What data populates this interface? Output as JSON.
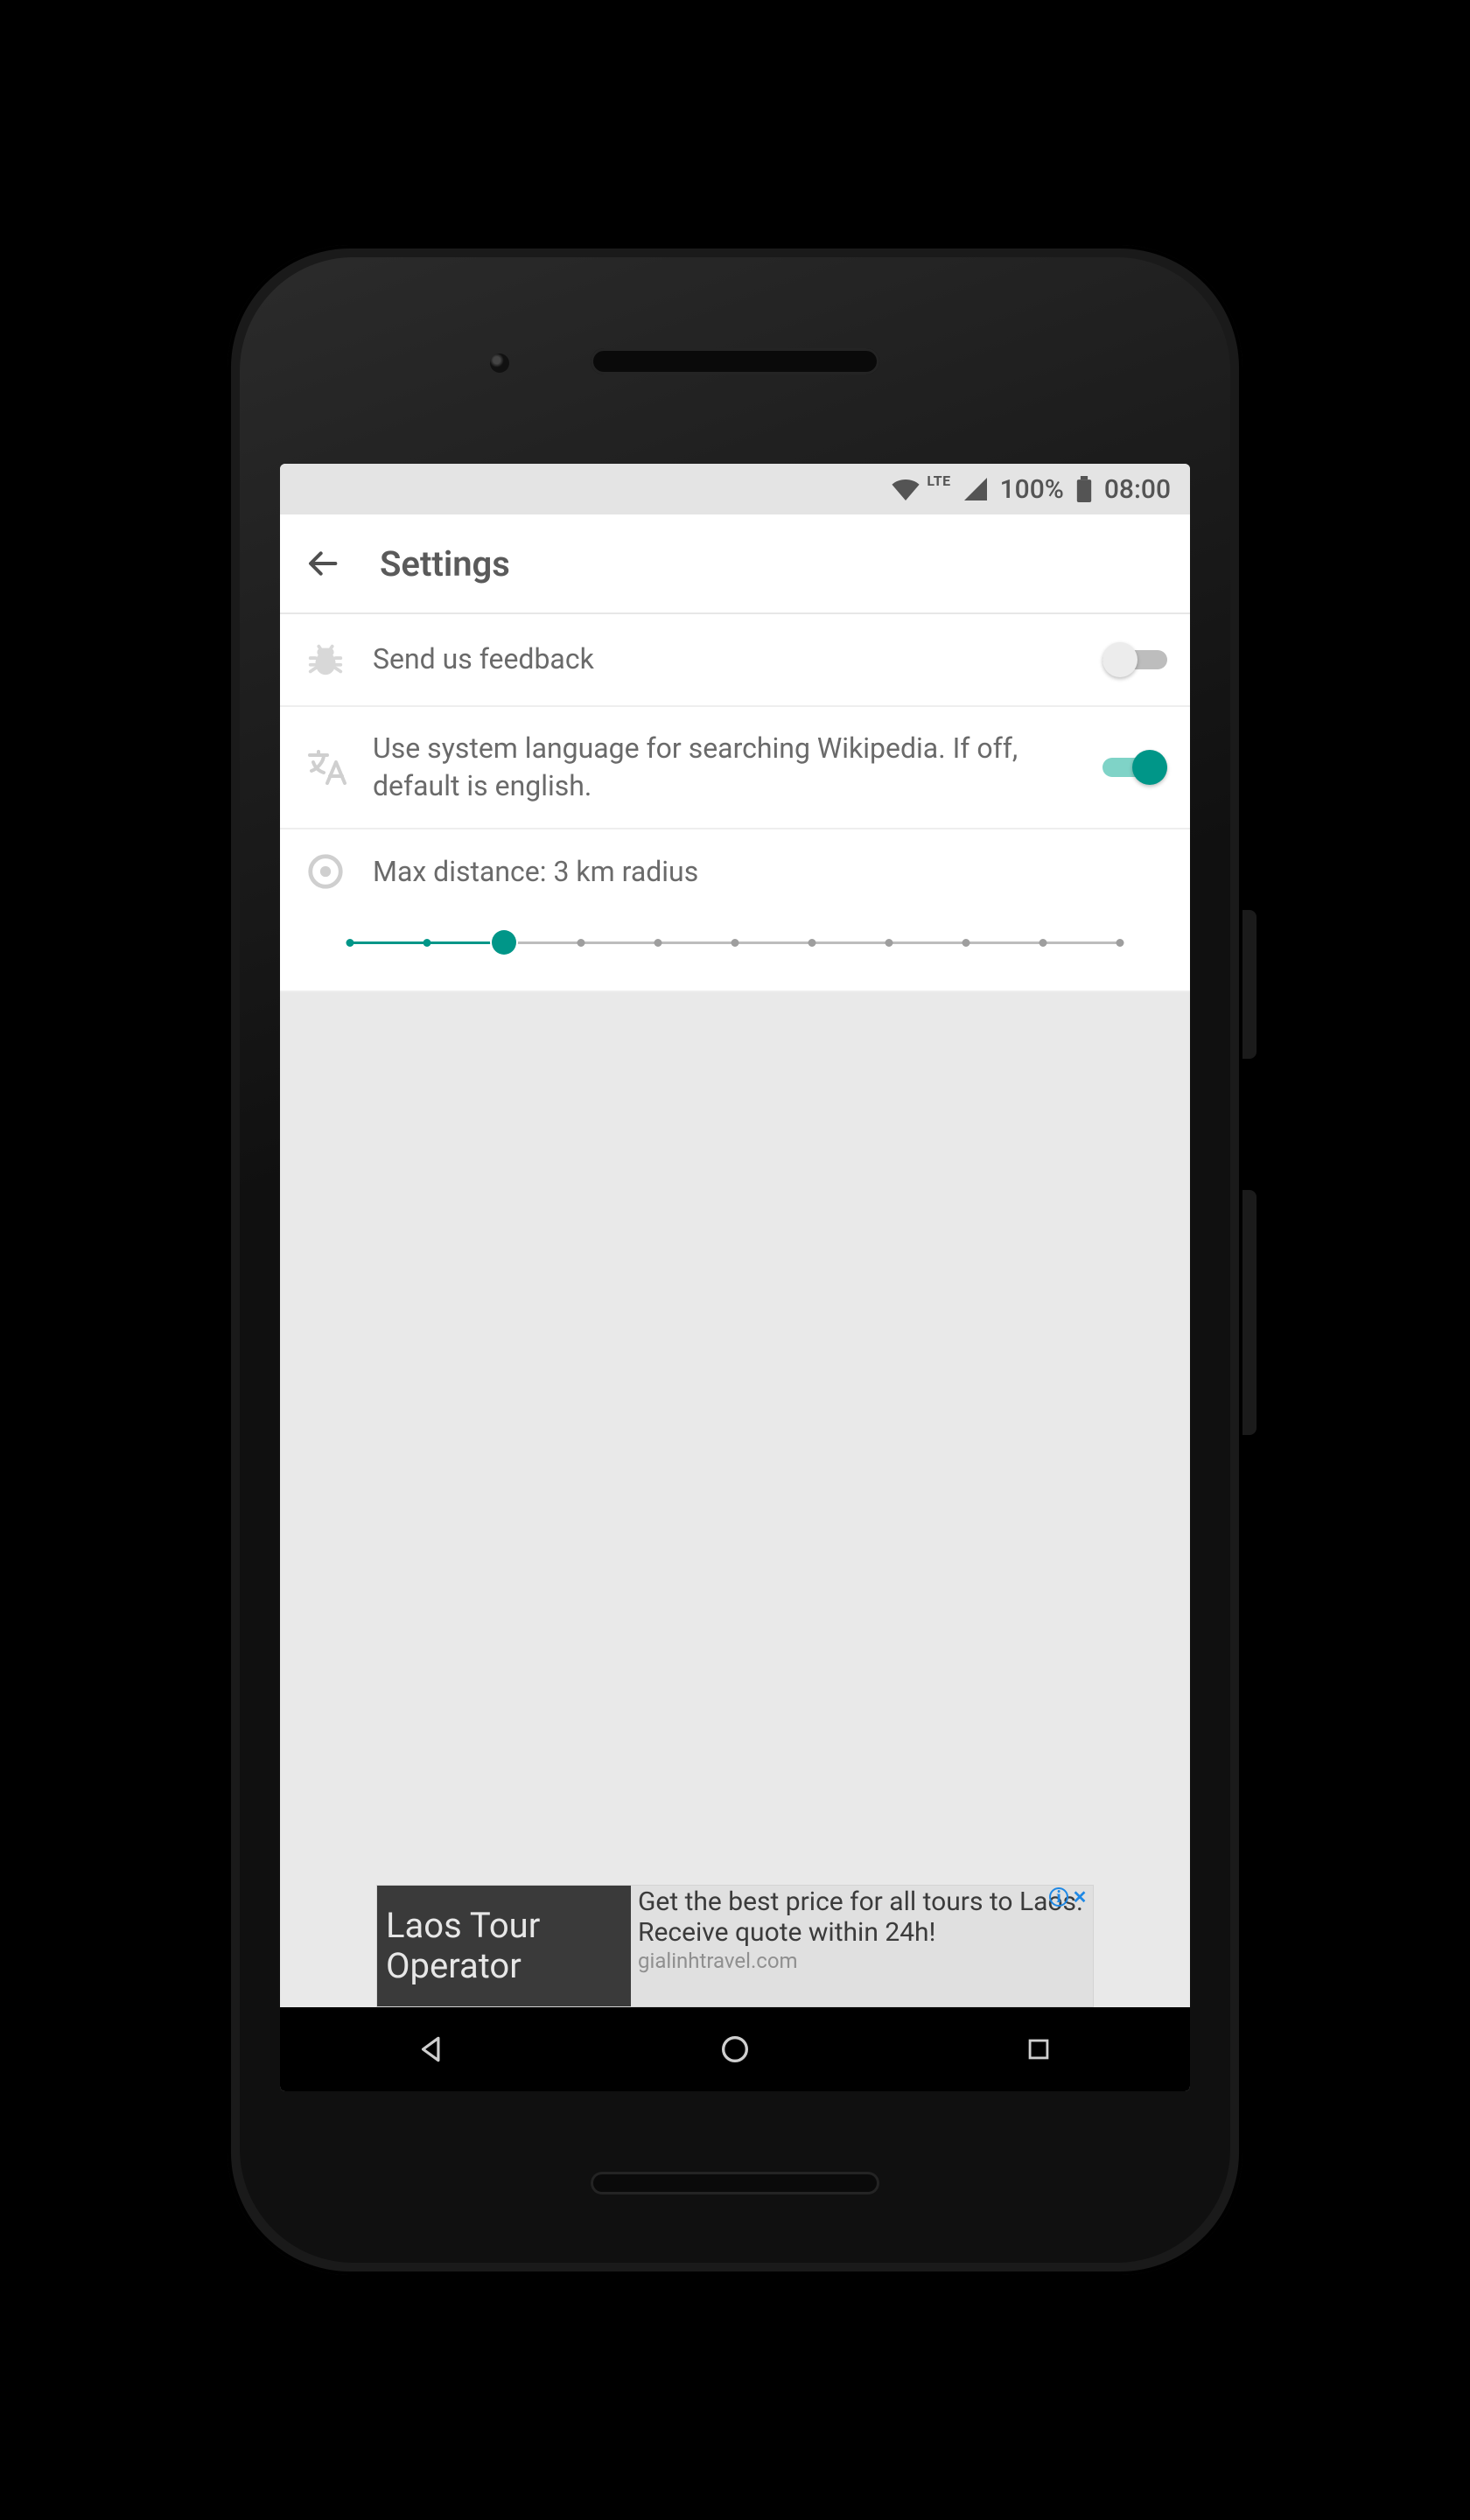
{
  "statusbar": {
    "battery_pct": "100%",
    "clock": "08:00",
    "network_label": "LTE"
  },
  "appbar": {
    "title": "Settings"
  },
  "settings": {
    "feedback": {
      "label": "Send us feedback",
      "toggle_on": false
    },
    "language": {
      "label": "Use system language for searching Wikipedia. If off, default is english.",
      "toggle_on": true
    },
    "distance": {
      "label": "Max distance: 3 km radius",
      "value_index": 2,
      "tick_count": 11
    }
  },
  "ad": {
    "headline": "Laos Tour Operator",
    "body": "Get the best price for all tours to Laos. Receive quote within 24h!",
    "display_url": "gialinhtravel.com"
  },
  "colors": {
    "accent": "#009688"
  }
}
